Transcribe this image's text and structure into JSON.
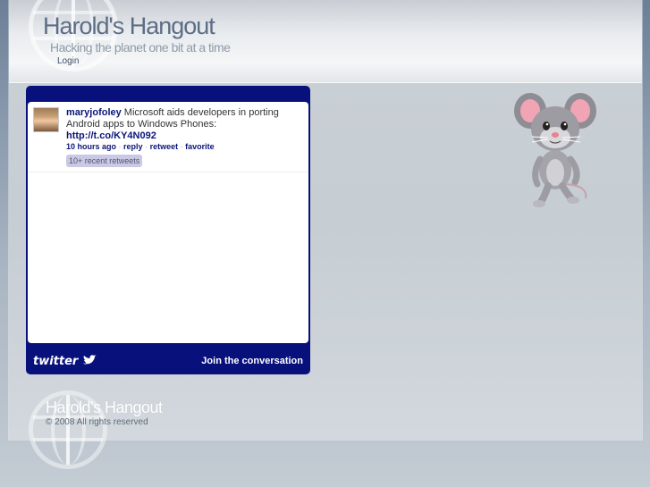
{
  "header": {
    "title": "Harold's Hangout",
    "tagline": "Hacking the planet one bit at a time",
    "login_label": "Login"
  },
  "twitter_widget": {
    "tweet": {
      "username": "maryjofoley",
      "text": " Microsoft aids developers in porting Android apps to Windows Phones: ",
      "url": "http://t.co/KY4N092",
      "time": "10 hours ago",
      "reply_label": "reply",
      "retweet_label": "retweet",
      "favorite_label": "favorite",
      "retweets_badge": "10+ recent retweets"
    },
    "brand_label": "twitter",
    "join_label": "Join the conversation"
  },
  "footer": {
    "title": "Harold's Hangout",
    "copyright": "© 2008 All rights reserved"
  },
  "colors": {
    "widget_blue": "#08107c",
    "link_blue": "#0a157a",
    "title_gray": "#5c6d86"
  },
  "icons": {
    "header_globe": "globe-icon",
    "footer_globe": "globe-icon",
    "mascot": "cartoon-mouse-image",
    "twitter_bird": "twitter-bird-icon"
  }
}
